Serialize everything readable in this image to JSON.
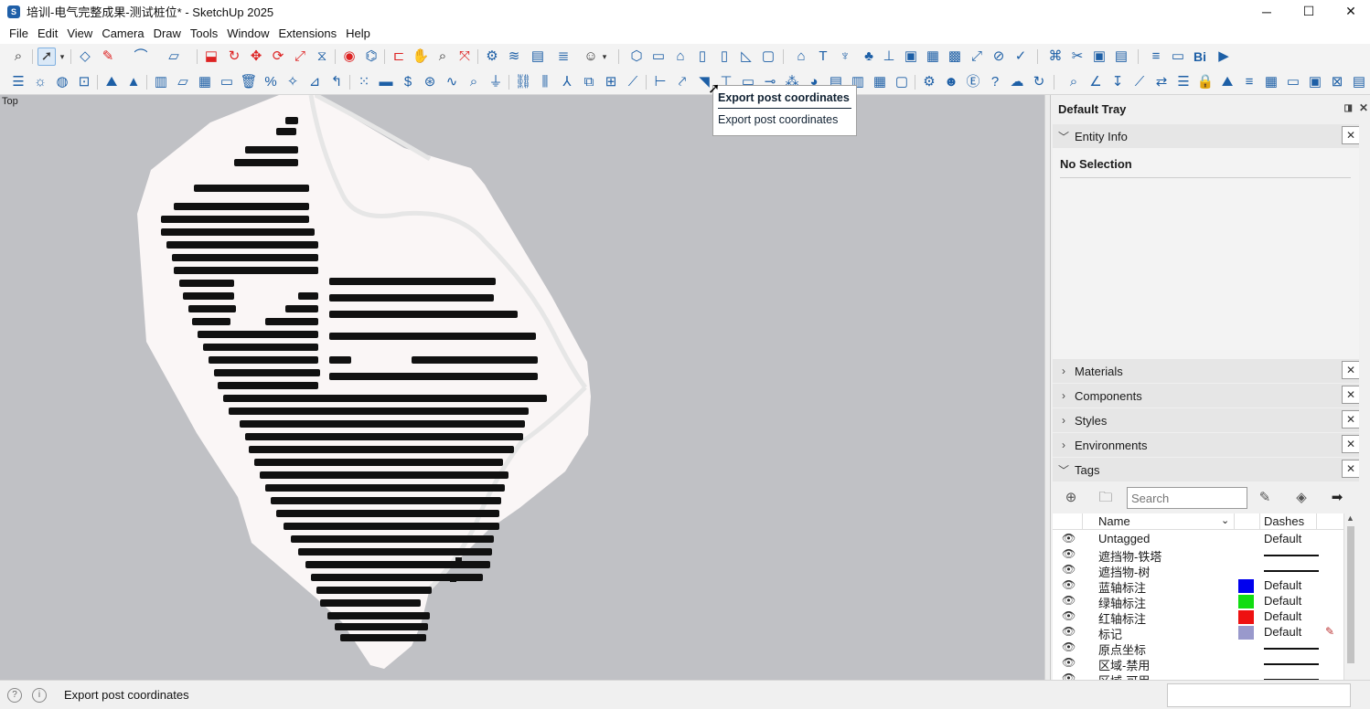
{
  "window": {
    "title": "培训-电气完整成果-测试桩位* - SketchUp 2025",
    "minimize": "─",
    "maximize": "☐",
    "close": "✕"
  },
  "menu": [
    "File",
    "Edit",
    "View",
    "Camera",
    "Draw",
    "Tools",
    "Window",
    "Extensions",
    "Help"
  ],
  "viewport": {
    "scene_label": "Top",
    "background_color": "#c0c1c5",
    "terrain_color": "#faf6f6",
    "array_color": "#111111"
  },
  "tooltip": {
    "title": "Export post coordinates",
    "description": "Export post coordinates"
  },
  "tray": {
    "title": "Default Tray",
    "pin_icon": "◨",
    "close_icon": "✕",
    "entity_info": {
      "label": "Entity Info",
      "status": "No Selection"
    },
    "panels": [
      "Materials",
      "Components",
      "Styles",
      "Environments"
    ],
    "tags": {
      "label": "Tags",
      "search_placeholder": "Search",
      "columns": {
        "name": "Name",
        "dashes": "Dashes"
      },
      "rows": [
        {
          "name": "Untagged",
          "color": "",
          "dashes": "Default"
        },
        {
          "name": "遮挡物-铁塔",
          "color": "",
          "dashes": ""
        },
        {
          "name": "遮挡物-树",
          "color": "",
          "dashes": ""
        },
        {
          "name": "蓝轴标注",
          "color": "#0000ee",
          "dashes": "Default"
        },
        {
          "name": "绿轴标注",
          "color": "#11dd11",
          "dashes": "Default"
        },
        {
          "name": "红轴标注",
          "color": "#ee1111",
          "dashes": "Default"
        },
        {
          "name": "标记",
          "color": "#9999cc",
          "dashes": "Default"
        },
        {
          "name": "原点坐标",
          "color": "",
          "dashes": ""
        },
        {
          "name": "区域-禁用",
          "color": "",
          "dashes": ""
        },
        {
          "name": "区域-可用",
          "color": "",
          "dashes": ""
        }
      ]
    }
  },
  "statusbar": {
    "text": "Export post coordinates"
  }
}
